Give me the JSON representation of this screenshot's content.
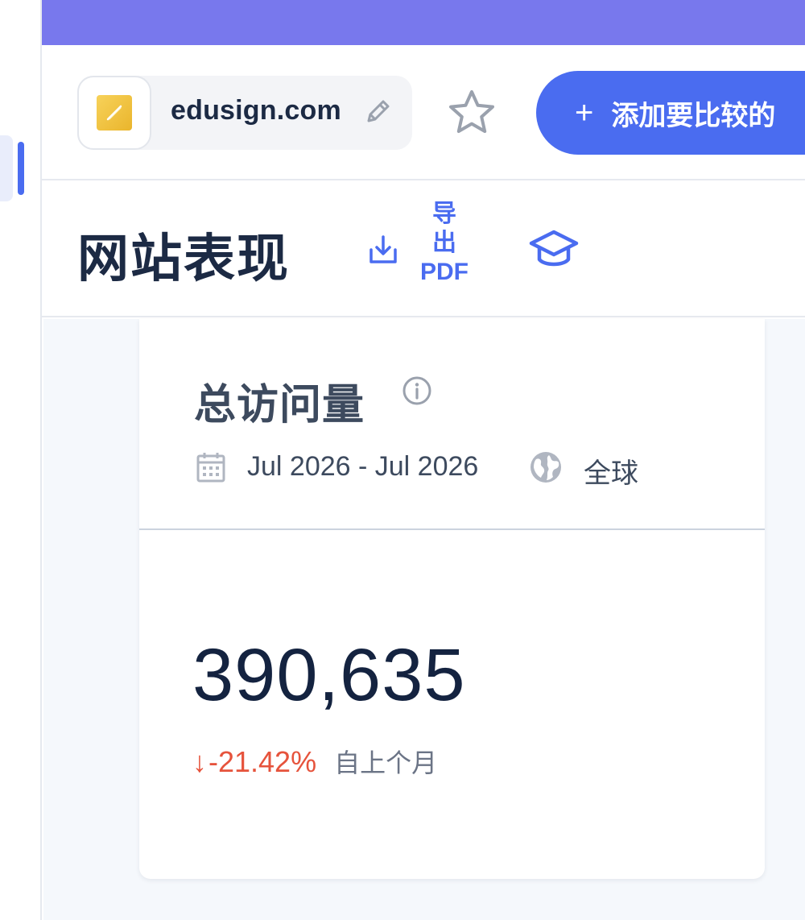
{
  "site": {
    "domain": "edusign.com"
  },
  "header": {
    "compare_button_icon": "+",
    "compare_button_label": "添加要比较的"
  },
  "title_row": {
    "title": "网站表现",
    "export_label_line1": "导",
    "export_label_line2": "出",
    "export_label_line3": "PDF"
  },
  "card": {
    "title": "总访问量",
    "date_range": "Jul 2026 - Jul 2026",
    "region": "全球",
    "value": "390,635",
    "delta_arrow": "↓",
    "delta": "-21.42%",
    "delta_caption": "自上个月"
  },
  "colors": {
    "topbar": "#7878ed",
    "accent": "#4a6cf0",
    "negative": "#e6533c",
    "text_dark": "#1c2a44"
  },
  "icons": [
    "edit-icon",
    "star-icon",
    "export-icon",
    "academy-icon",
    "info-icon",
    "calendar-icon",
    "globe-icon"
  ]
}
